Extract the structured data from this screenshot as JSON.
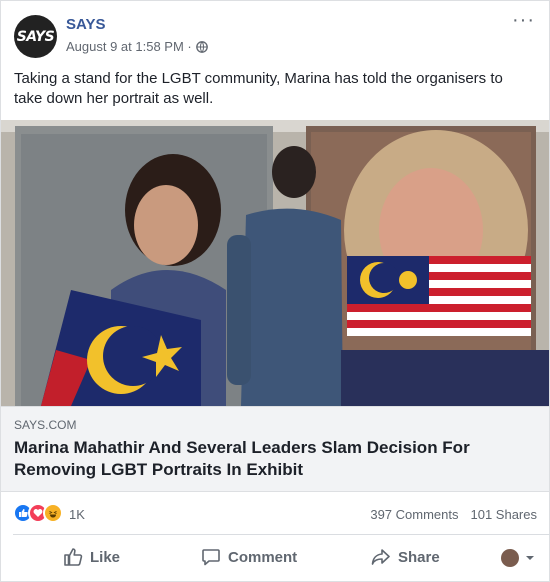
{
  "page": {
    "name": "SAYS",
    "avatar_text": "SAYS",
    "timestamp": "August 9 at 1:58 PM ·",
    "more": "···"
  },
  "post": {
    "text": "Taking a stand for the LGBT community, Marina has told the organisers to take down her portrait as well."
  },
  "link": {
    "domain": "SAYS.COM",
    "title": "Marina Mahathir And Several Leaders Slam Decision For Removing LGBT Portraits In Exhibit"
  },
  "engagement": {
    "reaction_count": "1K",
    "comments": "397 Comments",
    "shares": "101 Shares",
    "reactions": [
      "like-icon",
      "love-icon",
      "haha-icon"
    ]
  },
  "actions": {
    "like": "Like",
    "comment": "Comment",
    "share": "Share"
  },
  "colors": {
    "brand_blue": "#385898",
    "like_blue": "#1877f2",
    "love_red": "#f33e58",
    "haha_yellow": "#f7b125"
  }
}
